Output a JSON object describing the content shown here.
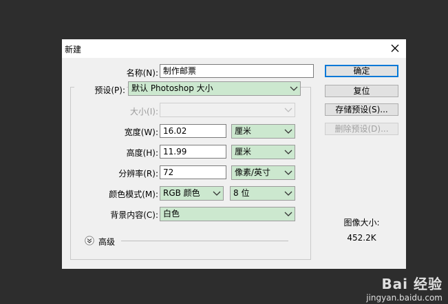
{
  "dialog": {
    "title": "新建",
    "name_label": "名称(N):",
    "name_value": "制作邮票",
    "preset_label": "预设(P):",
    "preset_value": "默认 Photoshop 大小",
    "size_label": "大小(I):",
    "size_value": "",
    "width_label": "宽度(W):",
    "width_value": "16.02",
    "width_unit": "厘米",
    "height_label": "高度(H):",
    "height_value": "11.99",
    "height_unit": "厘米",
    "resolution_label": "分辨率(R):",
    "resolution_value": "72",
    "resolution_unit": "像素/英寸",
    "color_mode_label": "颜色模式(M):",
    "color_mode_value": "RGB 颜色",
    "bit_depth_value": "8 位",
    "background_label": "背景内容(C):",
    "background_value": "白色",
    "advanced_label": "高级",
    "buttons": {
      "ok": "确定",
      "reset": "复位",
      "save_preset": "存储预设(S)...",
      "delete_preset": "删除预设(D)..."
    },
    "image_size_label": "图像大小:",
    "image_size_value": "452.2K"
  },
  "watermark": {
    "logo": "Bai 经验",
    "url": "jingyan.baidu.com"
  },
  "colors": {
    "background": "#2d2d2d",
    "dialog": "#f0f0f0",
    "select_fill": "#cce8cf",
    "default_button_border": "#0078d7"
  }
}
